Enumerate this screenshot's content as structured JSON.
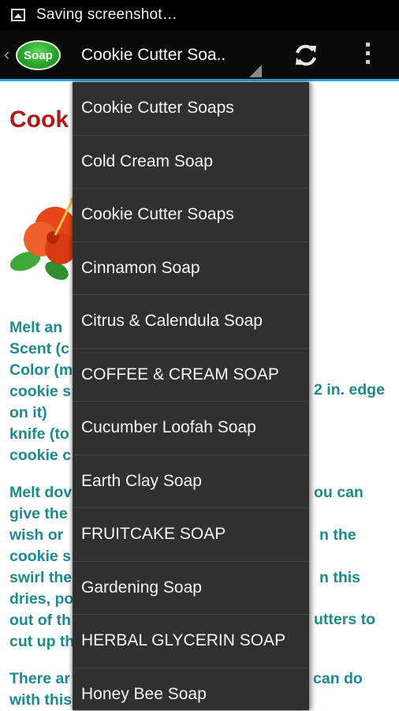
{
  "status_bar": {
    "text": "Saving screenshot…"
  },
  "action_bar": {
    "logo_text": "Soap",
    "spinner_title": "Cookie Cutter Soa.."
  },
  "page": {
    "title": "Cook",
    "paragraph1": [
      "Melt an",
      "Scent (c",
      "Color (m",
      "cookie s",
      "on it)",
      "knife (to",
      "cookie c"
    ],
    "paragraph1_right": "2 in. edge",
    "paragraph2": [
      "Melt dov",
      "give the",
      "wish or",
      "cookie s",
      "swirl the",
      "dries, po",
      "out of th",
      "cut up th"
    ],
    "paragraph2_right": [
      "ou can",
      "n the",
      "n this",
      "utters to"
    ],
    "paragraph3": [
      "There ar",
      "with this"
    ],
    "paragraph3_right": "can do"
  },
  "dropdown": {
    "items": [
      "Cookie Cutter Soaps",
      "Cold Cream Soap",
      "Cookie Cutter Soaps",
      "Cinnamon Soap",
      "Citrus & Calendula Soap",
      "COFFEE & CREAM SOAP",
      "Cucumber Loofah Soap",
      "Earth Clay Soap",
      "FRUITCAKE SOAP",
      "Gardening Soap",
      "HERBAL GLYCERIN SOAP",
      "Honey Bee Soap"
    ]
  }
}
